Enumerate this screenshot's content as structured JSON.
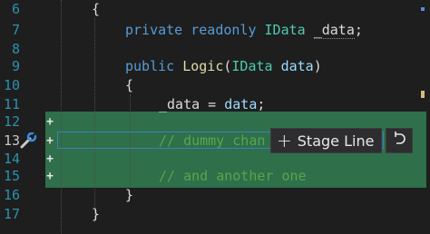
{
  "lines": [
    {
      "num": "6"
    },
    {
      "num": "7"
    },
    {
      "num": "8"
    },
    {
      "num": "9"
    },
    {
      "num": "10"
    },
    {
      "num": "11"
    },
    {
      "num": "12"
    },
    {
      "num": "13"
    },
    {
      "num": "14"
    },
    {
      "num": "15"
    },
    {
      "num": "16"
    },
    {
      "num": "17"
    }
  ],
  "code": {
    "l6_brace": "{",
    "l7_private": "private",
    "l7_readonly": "readonly",
    "l7_type": "IData",
    "l7_field": "_data",
    "l7_semi": ";",
    "l9_public": "public",
    "l9_method": "Logic",
    "l9_open": "(",
    "l9_type": "IData",
    "l9_param": "data",
    "l9_close": ")",
    "l10_brace": "{",
    "l11_field": "_data",
    "l11_eq": " = ",
    "l11_param": "data",
    "l11_semi": ";",
    "l13_comment": "// dummy chan",
    "l15_comment": "// and another one",
    "l16_brace": "}",
    "l17_brace": "}"
  },
  "diff": {
    "added_marker": "+",
    "stage_label": "Stage Line",
    "stage_icon": "plus-icon",
    "revert_icon": "undo-icon"
  },
  "colors": {
    "added_background": "#2f6f4a",
    "line_number": "#2b91af",
    "keyword": "#569cd6",
    "type": "#4ec9b0",
    "comment": "#57a64a"
  }
}
